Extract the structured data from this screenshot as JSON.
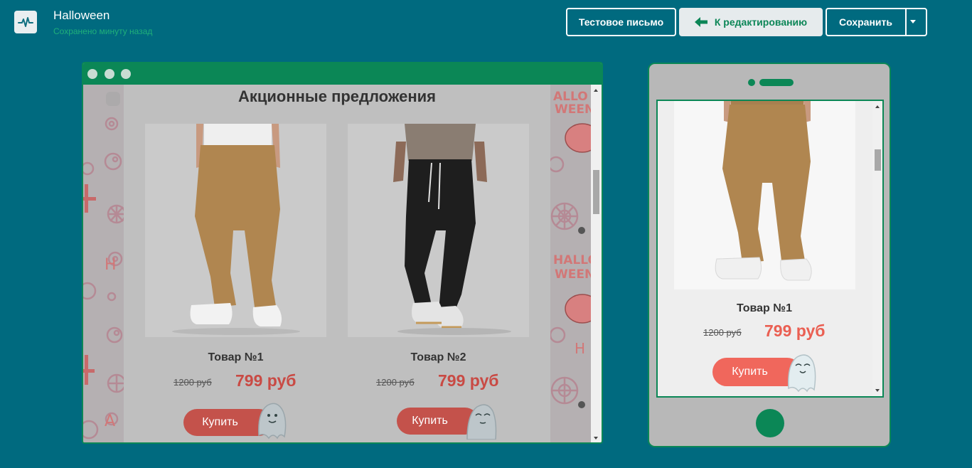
{
  "header": {
    "title": "Halloween",
    "saved_status": "Сохранено минуту назад",
    "test_email_label": "Тестовое письмо",
    "back_to_edit_label": "К редактированию",
    "save_label": "Сохранить",
    "logo_icon": "activity-pulse-icon",
    "back_icon": "arrow-left-icon",
    "dropdown_icon": "caret-down-icon"
  },
  "desktop_preview": {
    "email": {
      "heading": "Акционные предложения",
      "products": [
        {
          "name": "Товар №1",
          "old_price": "1200 руб",
          "new_price": "799 руб",
          "buy_label": "Купить",
          "image": "khaki-jogger-pants-photo"
        },
        {
          "name": "Товар №2",
          "old_price": "1200 руб",
          "new_price": "799 руб",
          "buy_label": "Купить",
          "image": "black-cargo-pants-photo"
        }
      ]
    },
    "background_pattern": "halloween-pattern",
    "pattern_text": "HALLOWEEN"
  },
  "mobile_preview": {
    "product": {
      "name": "Товар №1",
      "old_price": "1200 руб",
      "new_price": "799 руб",
      "buy_label": "Купить",
      "image": "khaki-jogger-pants-photo"
    }
  },
  "colors": {
    "background": "#006a7f",
    "accent_green": "#0b8756",
    "price_red": "#c94a44",
    "button_red": "#f0675c"
  }
}
